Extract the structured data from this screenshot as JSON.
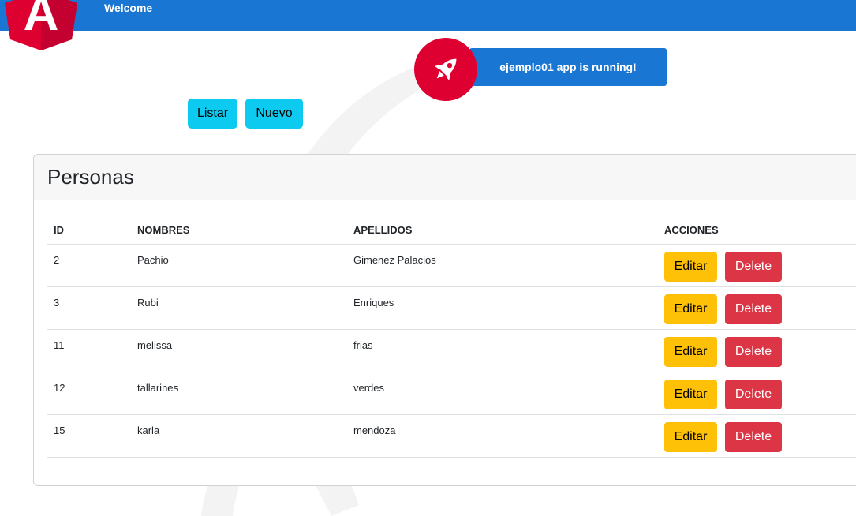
{
  "toolbar": {
    "welcome": "Welcome",
    "logo_letter": "A",
    "color": "#1976d2"
  },
  "banner": {
    "text": "ejemplo01 app is running!",
    "icon": "rocket-icon"
  },
  "nav": {
    "listar": "Listar",
    "nuevo": "Nuevo"
  },
  "card": {
    "title": "Personas"
  },
  "table": {
    "headers": {
      "id": "ID",
      "nombres": "NOMBRES",
      "apellidos": "APELLIDOS",
      "acciones": "ACCIONES"
    },
    "rows": [
      {
        "id": "2",
        "nombres": "Pachio",
        "apellidos": "Gimenez Palacios"
      },
      {
        "id": "3",
        "nombres": "Rubi",
        "apellidos": "Enriques"
      },
      {
        "id": "11",
        "nombres": "melissa",
        "apellidos": "frias"
      },
      {
        "id": "12",
        "nombres": "tallarines",
        "apellidos": "verdes"
      },
      {
        "id": "15",
        "nombres": "karla",
        "apellidos": "mendoza"
      }
    ],
    "edit_label": "Editar",
    "delete_label": "Delete"
  },
  "colors": {
    "accent": "#1976d2",
    "angular_red": "#dd0031",
    "info": "#0dcaf0",
    "warning": "#ffc107",
    "danger": "#dc3545"
  }
}
